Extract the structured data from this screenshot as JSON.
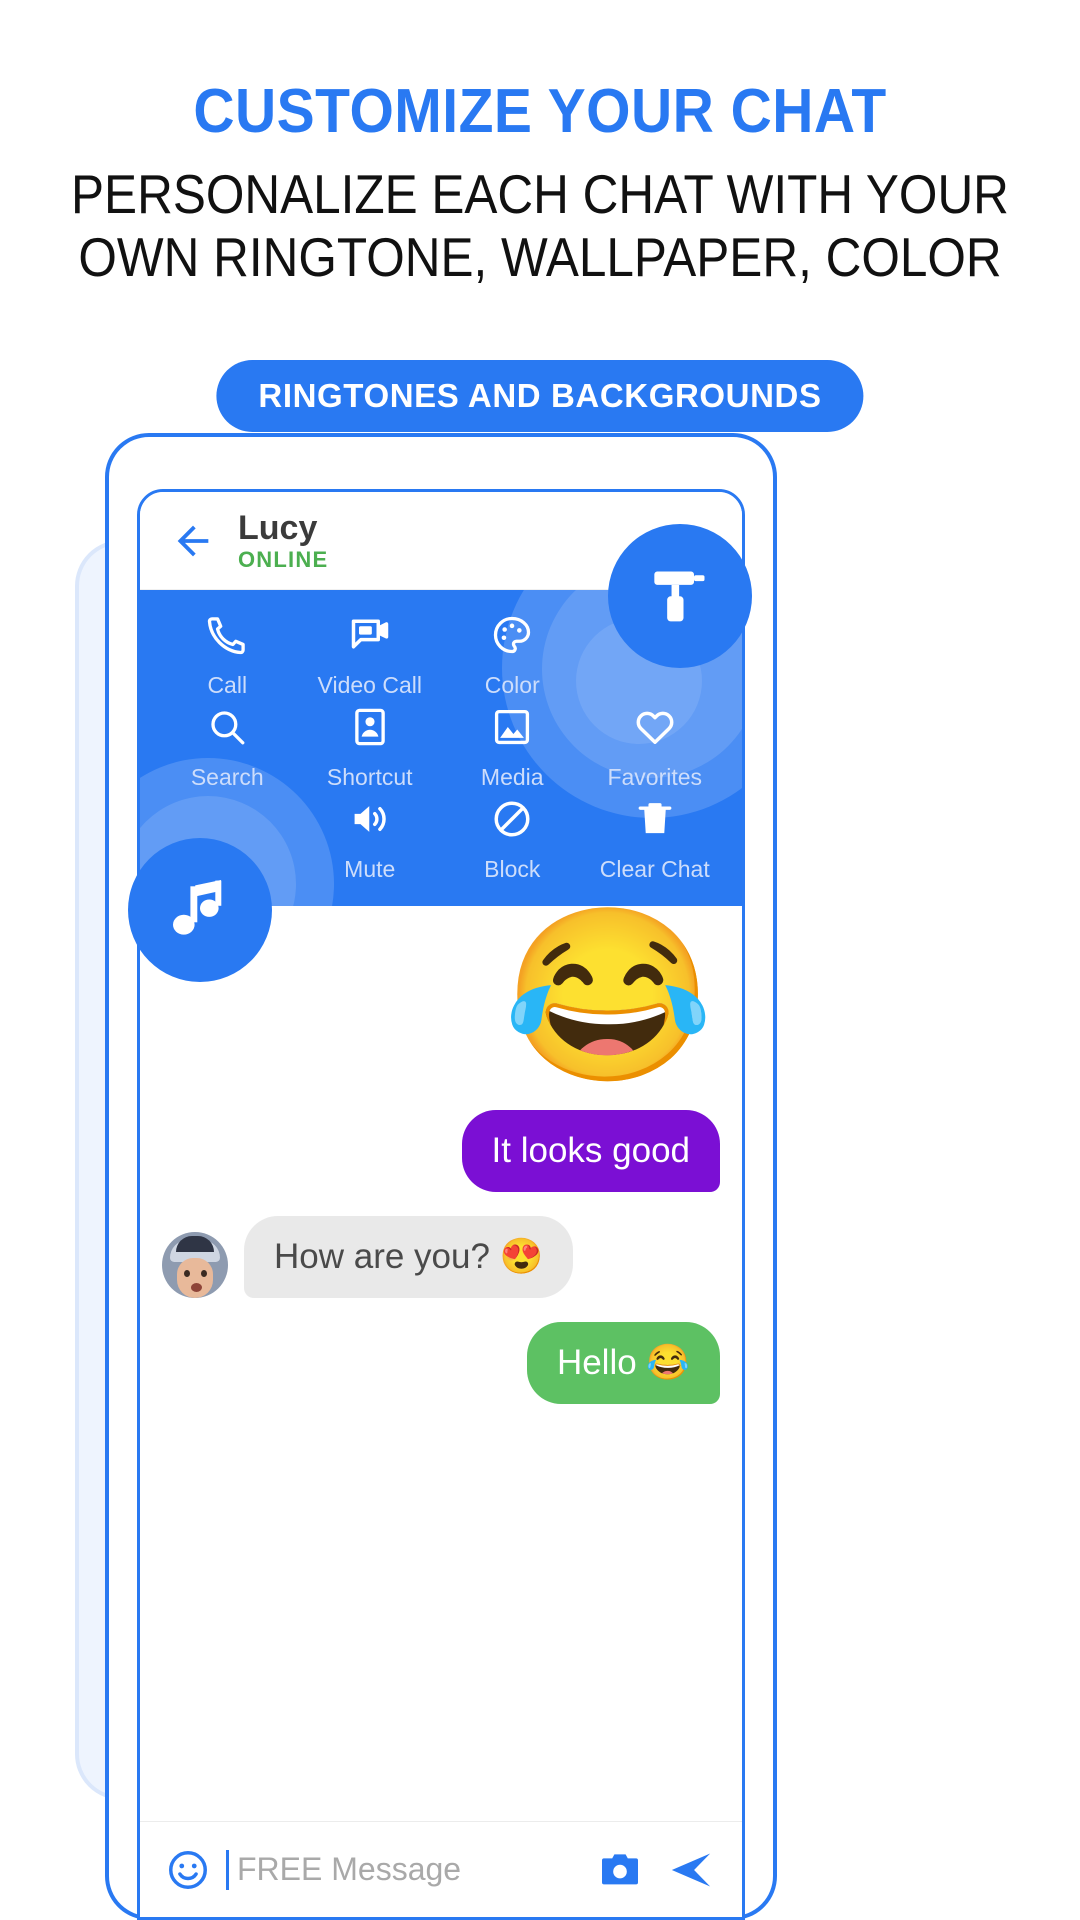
{
  "promo": {
    "title": "CUSTOMIZE YOUR CHAT",
    "subtitle_line1": "PERSONALIZE EACH CHAT WITH YOUR",
    "subtitle_line2": "OWN RINGTONE, WALLPAPER, COLOR",
    "cta_label": "RINGTONES AND BACKGROUNDS",
    "accent_color": "#2979f2",
    "title_color": "#2979f2",
    "subtitle_color": "#111111"
  },
  "chat_header": {
    "back_icon": "back-arrow-icon",
    "peer_name": "Lucy",
    "peer_status": "ONLINE",
    "status_color": "#4caf50"
  },
  "options_panel": {
    "background_color": "#2979f2",
    "label_color": "#cdddfb",
    "rows": [
      [
        {
          "icon": "phone-icon",
          "label": "Call"
        },
        {
          "icon": "video-call-icon",
          "label": "Video Call"
        },
        {
          "icon": "palette-icon",
          "label": "Color"
        },
        {
          "icon": "blank-icon",
          "label": ""
        }
      ],
      [
        {
          "icon": "search-icon",
          "label": "Search"
        },
        {
          "icon": "contact-card-icon",
          "label": "Shortcut"
        },
        {
          "icon": "image-icon",
          "label": "Media"
        },
        {
          "icon": "heart-icon",
          "label": "Favorites"
        }
      ],
      [
        {
          "icon": "blank-icon",
          "label": ""
        },
        {
          "icon": "speaker-icon",
          "label": "Mute"
        },
        {
          "icon": "block-icon",
          "label": "Block"
        },
        {
          "icon": "trash-icon",
          "label": "Clear Chat"
        }
      ]
    ]
  },
  "floating_buttons": [
    {
      "icon": "paint-roller-icon",
      "name": "wallpaper-fab",
      "color": "#2979f2"
    },
    {
      "icon": "music-note-icon",
      "name": "ringtone-fab",
      "color": "#2979f2"
    }
  ],
  "messages": [
    {
      "type": "emoji",
      "side": "right",
      "content": "😂"
    },
    {
      "type": "text",
      "side": "right",
      "content": "It looks good",
      "bubble_color": "#7b0fd4",
      "text_color": "#ffffff"
    },
    {
      "type": "text",
      "side": "left",
      "content": "How are you? 😍",
      "bubble_color": "#e9e9e9",
      "text_color": "#4a4a4a",
      "avatar": "peer-avatar"
    },
    {
      "type": "text",
      "side": "right",
      "content": "Hello 😂",
      "bubble_color": "#5dc163",
      "text_color": "#ffffff"
    }
  ],
  "composer": {
    "emoji_icon": "smiley-icon",
    "placeholder": "FREE Message",
    "camera_icon": "camera-icon",
    "send_icon": "send-icon"
  }
}
